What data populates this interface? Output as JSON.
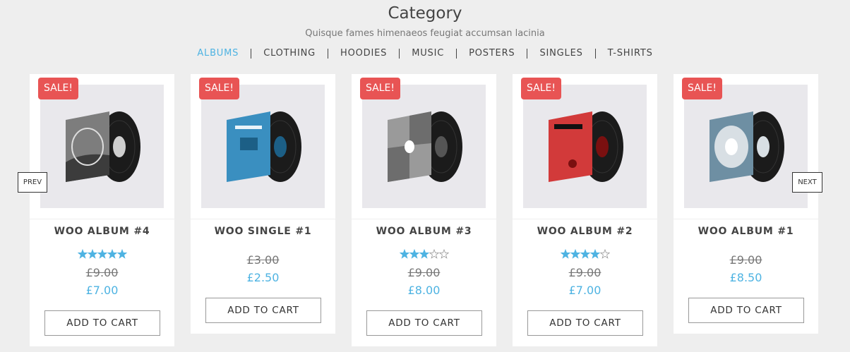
{
  "header": {
    "title": "Category",
    "subtitle": "Quisque fames himenaeos feugiat accumsan lacinia"
  },
  "categories": [
    {
      "label": "ALBUMS",
      "active": true
    },
    {
      "label": "CLOTHING",
      "active": false
    },
    {
      "label": "HOODIES",
      "active": false
    },
    {
      "label": "MUSIC",
      "active": false
    },
    {
      "label": "POSTERS",
      "active": false
    },
    {
      "label": "SINGLES",
      "active": false
    },
    {
      "label": "T-SHIRTS",
      "active": false
    }
  ],
  "carousel": {
    "prev_label": "PREV",
    "next_label": "NEXT"
  },
  "colors": {
    "accent": "#4eb3e2",
    "sale": "#e85454",
    "star": "#4eb3e2"
  },
  "products": [
    {
      "sale_badge": "SALE!",
      "name": "WOO ALBUM #4",
      "rating": 5,
      "old_price": "£9.00",
      "price": "£7.00",
      "button": "ADD TO CART",
      "cover": "grey-wave"
    },
    {
      "sale_badge": "SALE!",
      "name": "WOO SINGLE #1",
      "rating": null,
      "old_price": "£3.00",
      "price": "£2.50",
      "button": "ADD TO CART",
      "cover": "blue"
    },
    {
      "sale_badge": "SALE!",
      "name": "WOO ALBUM #3",
      "rating": 3,
      "old_price": "£9.00",
      "price": "£8.00",
      "button": "ADD TO CART",
      "cover": "grey-ninja"
    },
    {
      "sale_badge": "SALE!",
      "name": "WOO ALBUM #2",
      "rating": 4,
      "old_price": "£9.00",
      "price": "£7.00",
      "button": "ADD TO CART",
      "cover": "red"
    },
    {
      "sale_badge": "SALE!",
      "name": "WOO ALBUM #1",
      "rating": null,
      "old_price": "£9.00",
      "price": "£8.50",
      "button": "ADD TO CART",
      "cover": "slate-blue"
    }
  ]
}
